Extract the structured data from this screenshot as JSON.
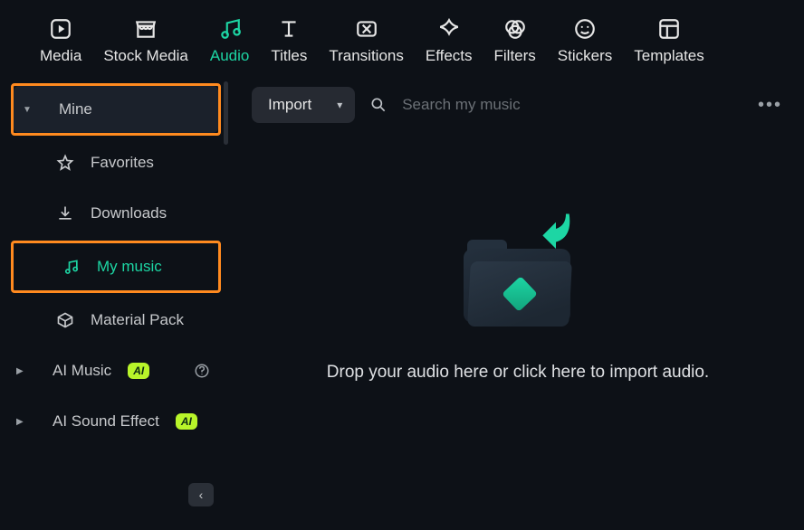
{
  "tabs": {
    "media": "Media",
    "stock_media": "Stock Media",
    "audio": "Audio",
    "titles": "Titles",
    "transitions": "Transitions",
    "effects": "Effects",
    "filters": "Filters",
    "stickers": "Stickers",
    "templates": "Templates"
  },
  "sidebar": {
    "mine": "Mine",
    "favorites": "Favorites",
    "downloads": "Downloads",
    "my_music": "My music",
    "material_pack": "Material Pack",
    "ai_music": "AI Music",
    "ai_sound_effect": "AI Sound Effect",
    "ai_badge": "AI"
  },
  "toolbar": {
    "import_label": "Import",
    "search_placeholder": "Search my music"
  },
  "drop": {
    "text": "Drop your audio here or click here to import audio."
  }
}
